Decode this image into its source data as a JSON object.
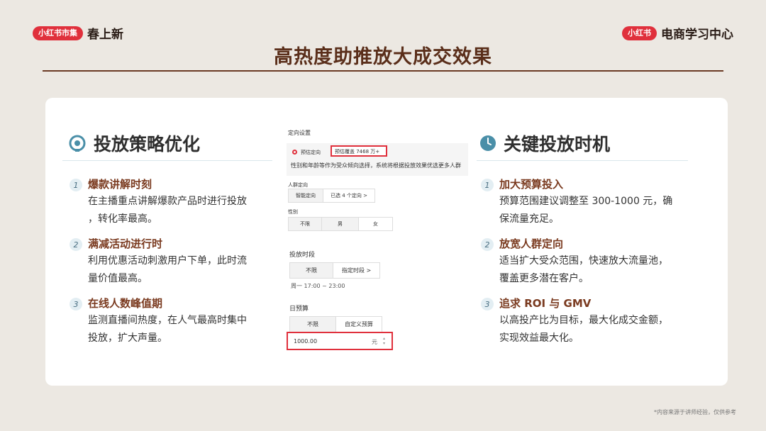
{
  "brand_left": {
    "pill": "小红书市集",
    "text": "春上新"
  },
  "brand_right": {
    "pill": "小红书",
    "text": "电商学习中心"
  },
  "page_title": "高热度助推放大成交效果",
  "left": {
    "title": "投放策略优化",
    "icon": "target-icon",
    "items": [
      {
        "num": "1",
        "title": "爆款讲解时刻",
        "desc_lines": [
          "在主播重点讲解爆款产品时进行投放",
          "，转化率最高。"
        ]
      },
      {
        "num": "2",
        "title": "满减活动进行时",
        "desc_lines": [
          "利用优惠活动刺激用户下单，此时流",
          "量价值最高。"
        ]
      },
      {
        "num": "3",
        "title": "在线人数峰值期",
        "desc_lines": [
          "监测直播间热度，在人气最高时集中",
          "投放，扩大声量。"
        ]
      }
    ]
  },
  "right": {
    "title": "关键投放时机",
    "icon": "clock-icon",
    "items": [
      {
        "num": "1",
        "title": "加大预算投入",
        "desc_lines": [
          "预算范围建议调整至 300-1000 元，确",
          "保流量充足。"
        ]
      },
      {
        "num": "2",
        "title": "放宽人群定向",
        "desc_lines": [
          "适当扩大受众范围，快速放大流量池，",
          "覆盖更多潜在客户。"
        ]
      },
      {
        "num": "3",
        "title": "追求 ROI 与 GMV",
        "desc_lines": [
          "以高投产比为目标，最大化成交金额，",
          "实现效益最大化。"
        ]
      }
    ]
  },
  "mock": {
    "targeting_title": "定向设置",
    "smart_label": "预估定向",
    "estimate": "预估覆盖 7468 万+",
    "hint": "性别和年龄等作为受众倾向选择，系统将根据投放效果优选更多人群",
    "crowd_label": "人群定向",
    "crowd_options": [
      "智能定向",
      "已选 4 个定向 >"
    ],
    "gender_label": "性别",
    "gender_options": [
      "不限",
      "男",
      "女"
    ],
    "period_label": "投放时段",
    "period_options": [
      "不限",
      "指定时段 >"
    ],
    "period_value": "周一 17:00 ~ 23:00",
    "budget_label": "日预算",
    "budget_options": [
      "不限",
      "自定义预算"
    ],
    "budget_value": "1000.00",
    "budget_unit": "元"
  },
  "footnote": "*内容来源于讲师经验，仅供参考",
  "colors": {
    "accent_red": "#e0303c",
    "title_brown": "#5a2e1a",
    "item_title": "#7a3a1f",
    "icon_teal": "#4a8fa8"
  }
}
